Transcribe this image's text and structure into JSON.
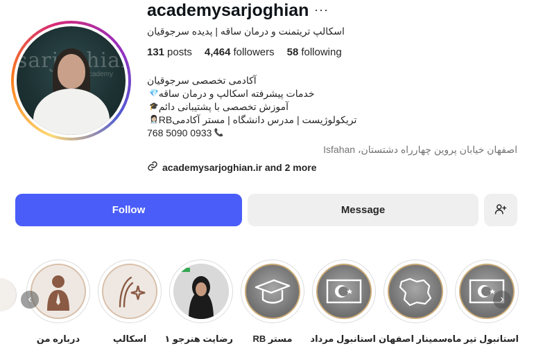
{
  "profile": {
    "username": "academysarjoghian",
    "full_name": "اسکالپ تریتمنت و درمان ساقه | پدیده سرجوقیان",
    "stats": {
      "posts": "131",
      "posts_label": "posts",
      "followers": "4,464",
      "followers_label": "followers",
      "following": "58",
      "following_label": "following"
    },
    "avatar_brand": "sarjoghian",
    "avatar_brand_sub": "academy",
    "bio": [
      {
        "text": "آکادمی تخصصی سرجوقیان",
        "emoji": "",
        "emoji_icon": ""
      },
      {
        "text": "خدمات پیشرفته اسکالپ و درمان ساقه",
        "emoji": "💎",
        "emoji_icon": "gem-icon"
      },
      {
        "text": "آموزش تخصصی با پشتیبانی دائم",
        "emoji": "🎓",
        "emoji_icon": "graduation-cap-icon"
      },
      {
        "text": "تریکولوژیست | مدرس دانشگاه | مستر آکادمیRB",
        "emoji": "👩🏻‍⚕️",
        "emoji_icon": "health-worker-icon"
      },
      {
        "text": "768 5090 0933",
        "emoji": "📞",
        "emoji_icon": "phone-icon"
      }
    ],
    "location": "اصفهان خیابان پروین چهارراه دشتستان، Isfahan",
    "link_text": "academysarjoghian.ir and 2 more"
  },
  "actions": {
    "follow": "Follow",
    "message": "Message"
  },
  "colors": {
    "follow_button": "#4a5df9",
    "secondary_button": "#efefef"
  },
  "highlights": [
    {
      "label": "درباره من",
      "icon": "person-silhouette-icon",
      "style": "light"
    },
    {
      "label": "اسکالپ",
      "icon": "hair-sparkle-icon",
      "style": "light"
    },
    {
      "label": "رضایت هنرجو ۱",
      "icon": "student-photo",
      "style": "photo"
    },
    {
      "label": "مستر RB",
      "icon": "graduation-cap-icon",
      "style": "dark"
    },
    {
      "label": "استانبول مرداد",
      "icon": "turkey-flag-icon",
      "style": "dark"
    },
    {
      "label": "سمینار اصفهان",
      "icon": "iran-map-icon",
      "style": "dark"
    },
    {
      "label": "استانبول تیر ماه",
      "icon": "turkey-flag-icon",
      "style": "dark"
    }
  ]
}
